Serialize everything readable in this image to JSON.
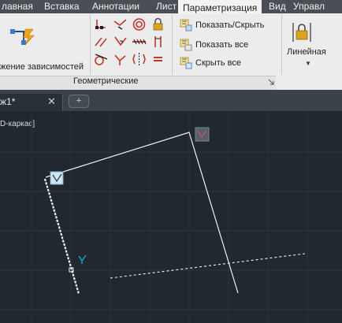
{
  "ribbon": {
    "tabs": [
      {
        "label": "лавная",
        "active": false
      },
      {
        "label": "Вставка",
        "active": false
      },
      {
        "label": "Аннотации",
        "active": false
      },
      {
        "label": "Лист",
        "active": false
      },
      {
        "label": "Параметризация",
        "active": true
      },
      {
        "label": "Вид",
        "active": false
      },
      {
        "label": "Управл",
        "active": false
      }
    ],
    "big_button_label": "жение зависимостей",
    "group_title": "Геометрические",
    "visibility": {
      "show_hide": "Показать/Скрыть",
      "show_all": "Показать все",
      "hide_all": "Скрыть все"
    },
    "dimension_button": "Линейная"
  },
  "file_tab": {
    "label": "ж1*",
    "close": "✕",
    "new_tab": "+"
  },
  "viewport": {
    "label": "D-каркас]"
  },
  "colors": {
    "ribbon_bg": "#ececec",
    "tab_bar": "#4a4f56",
    "canvas": "#212830",
    "line": "#ffffff",
    "constraint_marker": "#cfe4f3",
    "ucs_marker": "#1e9fd6"
  }
}
